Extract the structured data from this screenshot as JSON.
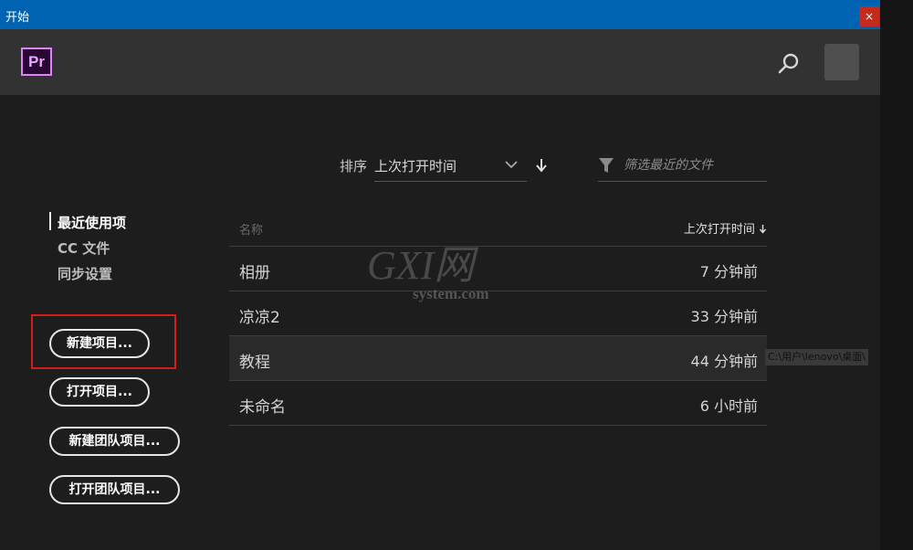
{
  "window": {
    "title": "开始",
    "close_label": "×"
  },
  "app": {
    "logo_text": "Pr"
  },
  "header": {
    "search_icon": "search-icon",
    "avatar": "user-avatar"
  },
  "sort": {
    "label": "排序",
    "selected": "上次打开时间",
    "direction": "descending"
  },
  "filter": {
    "placeholder": "筛选最近的文件"
  },
  "nav": {
    "items": [
      {
        "label": "最近使用项",
        "active": true
      },
      {
        "label": "CC 文件",
        "active": false
      },
      {
        "label": "同步设置",
        "active": false
      }
    ]
  },
  "actions": {
    "new_project": "新建项目...",
    "open_project": "打开项目...",
    "new_team_project": "新建团队项目...",
    "open_team_project": "打开团队项目..."
  },
  "table": {
    "col_name": "名称",
    "col_time": "上次打开时间",
    "rows": [
      {
        "name": "相册",
        "time": "7 分钟前"
      },
      {
        "name": "凉凉2",
        "time": "33 分钟前"
      },
      {
        "name": "教程",
        "time": "44 分钟前"
      },
      {
        "name": "未命名",
        "time": "6 小时前"
      }
    ]
  },
  "tooltip": {
    "text": "C:\\用户\\lenovo\\桌面\\"
  },
  "watermark": {
    "big": "GXI网",
    "small": "system.com"
  },
  "colors": {
    "titlebar": "#0063b1",
    "close": "#c42b1c",
    "highlight": "#d61b1b",
    "logo_border": "#d985f5"
  }
}
